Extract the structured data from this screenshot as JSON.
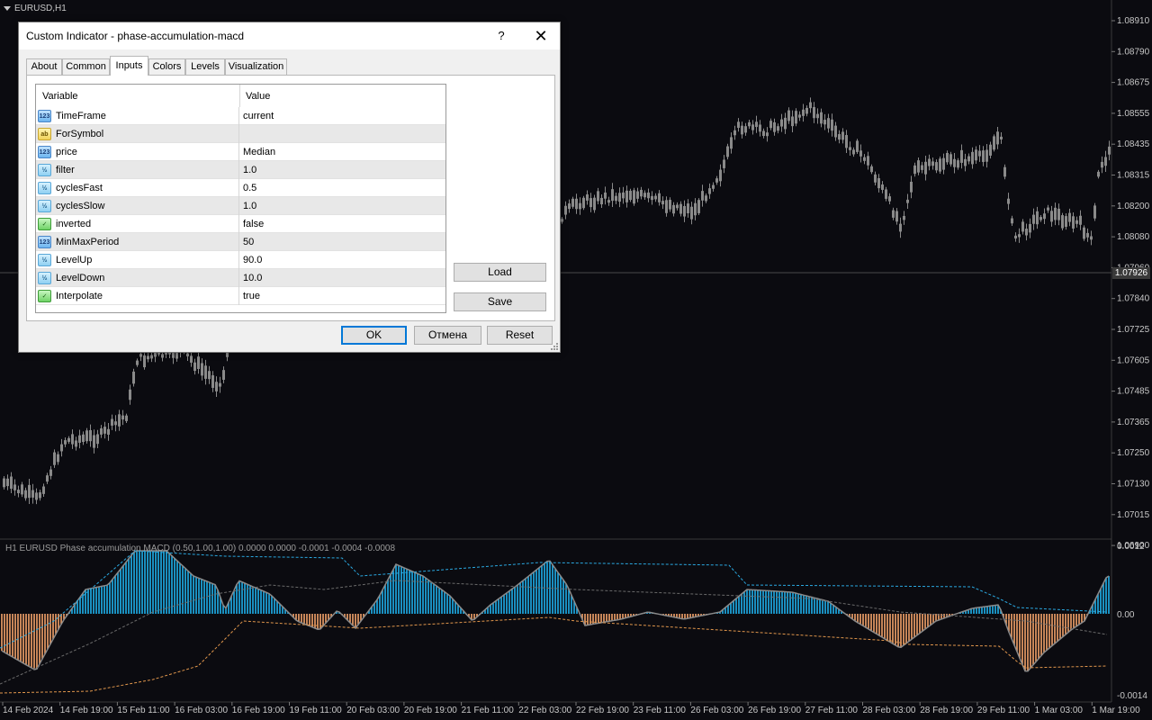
{
  "chart": {
    "symbol_label": "EURUSD,H1",
    "current_price": "1.07926",
    "price_axis": [
      "1.08910",
      "1.08790",
      "1.08675",
      "1.08555",
      "1.08435",
      "1.08315",
      "1.08200",
      "1.08080",
      "1.07960",
      "1.07840",
      "1.07725",
      "1.07605",
      "1.07485",
      "1.07365",
      "1.07250",
      "1.07130",
      "1.07015",
      "1.06900"
    ],
    "indicator_title": "H1 EURUSD Phase accumulation MACD (0.50,1.00,1.00) 0.0000 0.0000 -0.0001 -0.0004 -0.0008",
    "indicator_axis": [
      "0.0012",
      "0.00",
      "-0.0014"
    ],
    "time_axis": [
      "14 Feb 2024",
      "14 Feb 19:00",
      "15 Feb 11:00",
      "16 Feb 03:00",
      "16 Feb 19:00",
      "19 Feb 11:00",
      "20 Feb 03:00",
      "20 Feb 19:00",
      "21 Feb 11:00",
      "22 Feb 03:00",
      "22 Feb 19:00",
      "23 Feb 11:00",
      "26 Feb 03:00",
      "26 Feb 19:00",
      "27 Feb 11:00",
      "28 Feb 03:00",
      "28 Feb 19:00",
      "29 Feb 11:00",
      "1 Mar 03:00",
      "1 Mar 19:00"
    ],
    "colors": {
      "background": "#0b0b10",
      "candle": "#8a8a8a",
      "hist_up": "#1fb1ec",
      "hist_down": "#f5a46a",
      "level_up_line": "#2aa8e0",
      "level_down_line": "#e0964c",
      "signal_line": "#6a6a6a"
    }
  },
  "dialog": {
    "title": "Custom Indicator - phase-accumulation-macd",
    "help_label": "?",
    "close_label": "✕",
    "tabs": [
      {
        "label": "About"
      },
      {
        "label": "Common"
      },
      {
        "label": "Inputs"
      },
      {
        "label": "Colors"
      },
      {
        "label": "Levels"
      },
      {
        "label": "Visualization"
      }
    ],
    "active_tab": "Inputs",
    "grid": {
      "col_variable": "Variable",
      "col_value": "Value",
      "rows": [
        {
          "icon": "int-type-icon",
          "glyph": "123",
          "name": "TimeFrame",
          "value": "current"
        },
        {
          "icon": "string-type-icon",
          "glyph": "ab",
          "name": "ForSymbol",
          "value": ""
        },
        {
          "icon": "int-type-icon",
          "glyph": "123",
          "name": "price",
          "value": "Median"
        },
        {
          "icon": "double-type-icon",
          "glyph": "½",
          "name": "filter",
          "value": "1.0"
        },
        {
          "icon": "double-type-icon",
          "glyph": "½",
          "name": "cyclesFast",
          "value": "0.5"
        },
        {
          "icon": "double-type-icon",
          "glyph": "½",
          "name": "cyclesSlow",
          "value": "1.0"
        },
        {
          "icon": "bool-type-icon",
          "glyph": "✓",
          "name": "inverted",
          "value": "false"
        },
        {
          "icon": "int-type-icon",
          "glyph": "123",
          "name": "MinMaxPeriod",
          "value": "50"
        },
        {
          "icon": "double-type-icon",
          "glyph": "½",
          "name": "LevelUp",
          "value": "90.0"
        },
        {
          "icon": "double-type-icon",
          "glyph": "½",
          "name": "LevelDown",
          "value": "10.0"
        },
        {
          "icon": "bool-type-icon",
          "glyph": "✓",
          "name": "Interpolate",
          "value": "true"
        }
      ]
    },
    "buttons": {
      "load": "Load",
      "save": "Save",
      "ok": "OK",
      "cancel": "Отмена",
      "reset": "Reset"
    }
  }
}
